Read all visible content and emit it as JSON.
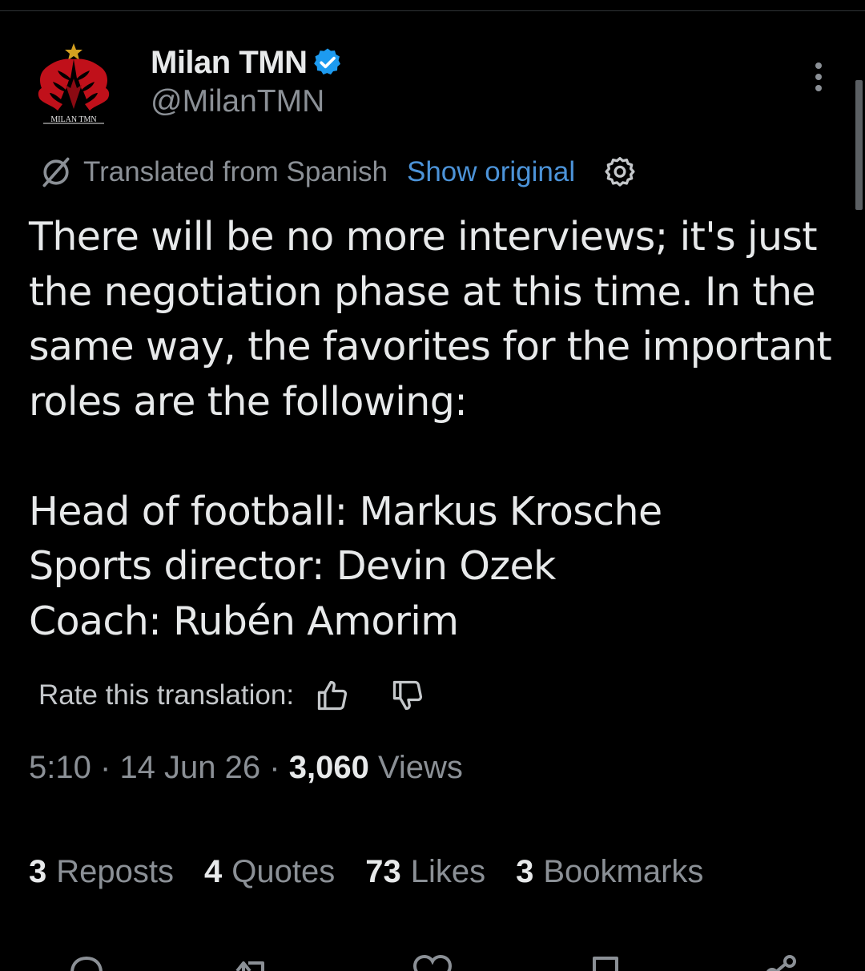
{
  "author": {
    "display_name": "Milan TMN",
    "handle": "@MilanTMN",
    "avatar_text": "MILAN TMN",
    "verified_icon": "verified-badge-icon",
    "verified_color": "#1d9bf0"
  },
  "translation": {
    "label": "Translated from Spanish",
    "show_original": "Show original",
    "link_color": "#4c93d8"
  },
  "tweet": {
    "paragraph_1": "There will be no more interviews; it's just the negotiation phase at this time. In the same way, the favorites for the important roles are the following:",
    "lines": [
      "Head of football: Markus Krosche",
      "Sports director: Devin Ozek",
      "Coach: Rubén Amorim"
    ]
  },
  "rate": {
    "label": "Rate this translation:"
  },
  "meta": {
    "time": "5:10",
    "separator": "·",
    "date": "14 Jun 26",
    "views_count": "3,060",
    "views_label": "Views"
  },
  "stats": {
    "reposts": {
      "count": "3",
      "label": "Reposts"
    },
    "quotes": {
      "count": "4",
      "label": "Quotes"
    },
    "likes": {
      "count": "73",
      "label": "Likes"
    },
    "bookmarks": {
      "count": "3",
      "label": "Bookmarks"
    }
  },
  "icons": {
    "more": "more-vertical-icon",
    "translate": "translate-icon",
    "settings": "settings-gear-icon",
    "thumbs_up": "thumbs-up-icon",
    "thumbs_down": "thumbs-down-icon",
    "reply": "reply-icon",
    "repost": "repost-icon",
    "like": "like-icon",
    "bookmark": "bookmark-icon",
    "share": "share-icon"
  }
}
